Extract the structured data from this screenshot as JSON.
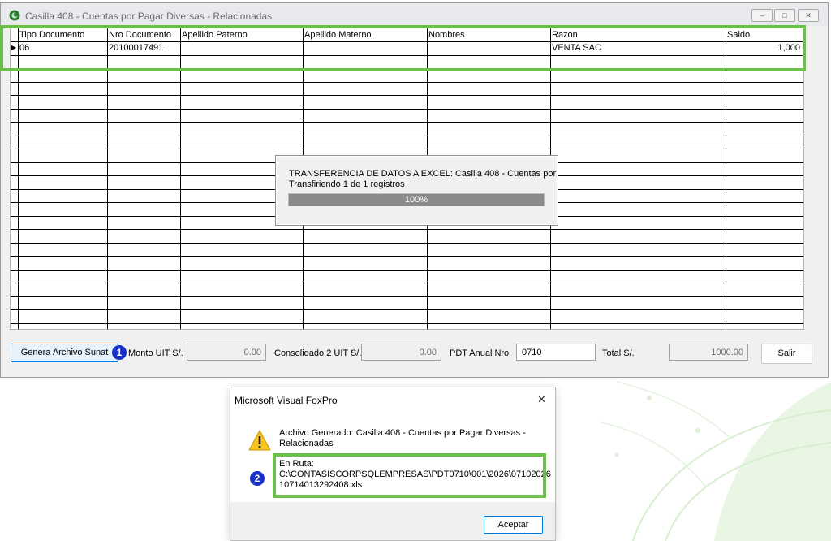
{
  "window": {
    "title": "Casilla 408 - Cuentas por Pagar Diversas - Relacionadas",
    "controls": {
      "minimize": "–",
      "maximize": "□",
      "close": "✕"
    }
  },
  "grid": {
    "columns": [
      "Tipo Documento",
      "Nro Documento",
      "Apellido Paterno",
      "Apellido Materno",
      "Nombres",
      "Razon",
      "Saldo"
    ],
    "rows": [
      [
        "06",
        "20100017491",
        "",
        "",
        "",
        "VENTA SAC",
        "1,000"
      ]
    ],
    "current_row_marker": "▶"
  },
  "progress": {
    "title_line": "TRANSFERENCIA DE DATOS A EXCEL: Casilla 408 - Cuentas por",
    "detail_line": "Transfiriendo 1 de 1 registros",
    "percent_label": "100%",
    "fraction": 1.0
  },
  "toolbar": {
    "generate_label": "Genera Archivo Sunat",
    "monto_uit_label": "Monto UIT S/.",
    "monto_uit_value": "0.00",
    "consolidado_label": "Consolidado 2 UIT S/.",
    "consolidado_value": "0.00",
    "pdt_label": "PDT Anual Nro",
    "pdt_value": "0710",
    "total_label": "Total S/.",
    "total_value": "1000.00",
    "exit_label": "Salir"
  },
  "badges": {
    "one": "1",
    "two": "2"
  },
  "message_box": {
    "title": "Microsoft Visual FoxPro",
    "close": "✕",
    "line1": "Archivo Generado: Casilla 408 - Cuentas por Pagar Diversas -",
    "line2": "Relacionadas",
    "path_label": "En Ruta:",
    "path_line1": "C:\\CONTASISCORPSQLEMPRESAS\\PDT0710\\001\\2026\\07102026",
    "path_line2": "10714013292408.xls",
    "ok_label": "Aceptar",
    "icon": "warning-icon"
  },
  "colors": {
    "highlight": "#6cc04a",
    "badge": "#1730c8",
    "progress_fill": "#8a8a8a"
  }
}
